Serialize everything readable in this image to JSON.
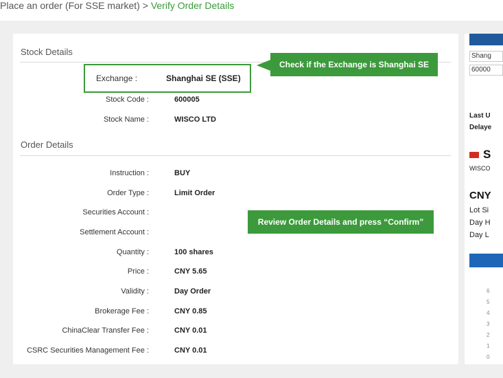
{
  "breadcrumb": {
    "parent": "Place an order (For SSE market)",
    "separator": " > ",
    "current": "Verify Order Details"
  },
  "stock_details": {
    "title": "Stock Details",
    "exchange_label": "Exchange :",
    "exchange_value": "Shanghai SE (SSE)",
    "rows": [
      {
        "label": "Stock Code :",
        "value": "600005"
      },
      {
        "label": "Stock Name :",
        "value": "WISCO LTD"
      }
    ]
  },
  "order_details": {
    "title": "Order Details",
    "rows": [
      {
        "label": "Instruction :",
        "value": "BUY"
      },
      {
        "label": "Order Type :",
        "value": "Limit Order"
      },
      {
        "label": "Securities Account :",
        "value": ""
      },
      {
        "label": "Settlement Account :",
        "value": ""
      },
      {
        "label": "Quantity :",
        "value": "100  shares"
      },
      {
        "label": "Price :",
        "value": "CNY 5.65"
      },
      {
        "label": "Validity :",
        "value": "Day Order"
      },
      {
        "label": "Brokerage Fee :",
        "value": "CNY 0.85"
      },
      {
        "label": "ChinaClear Transfer Fee :",
        "value": "CNY 0.01"
      },
      {
        "label": "CSRC Securities Management Fee :",
        "value": "CNY 0.01"
      }
    ]
  },
  "callouts": {
    "exchange": "Check if the Exchange is Shanghai SE",
    "review": "Review Order Details and press “Confirm”"
  },
  "side_panel": {
    "market_select": "Shang",
    "code_input": "60000",
    "last_update": "Last U",
    "delayed": "Delaye",
    "stock_code_prefix": "S",
    "stock_name": "WISCO",
    "currency": "CNY",
    "lot_size": "Lot Si",
    "day_high": "Day H",
    "day_low": "Day L",
    "axis_ticks": [
      "6",
      "5",
      "4",
      "3",
      "2",
      "1",
      "0"
    ],
    "colors": {
      "flag": "#d52b1e",
      "button": "#1e67b8",
      "header": "#1e5a9c"
    }
  }
}
